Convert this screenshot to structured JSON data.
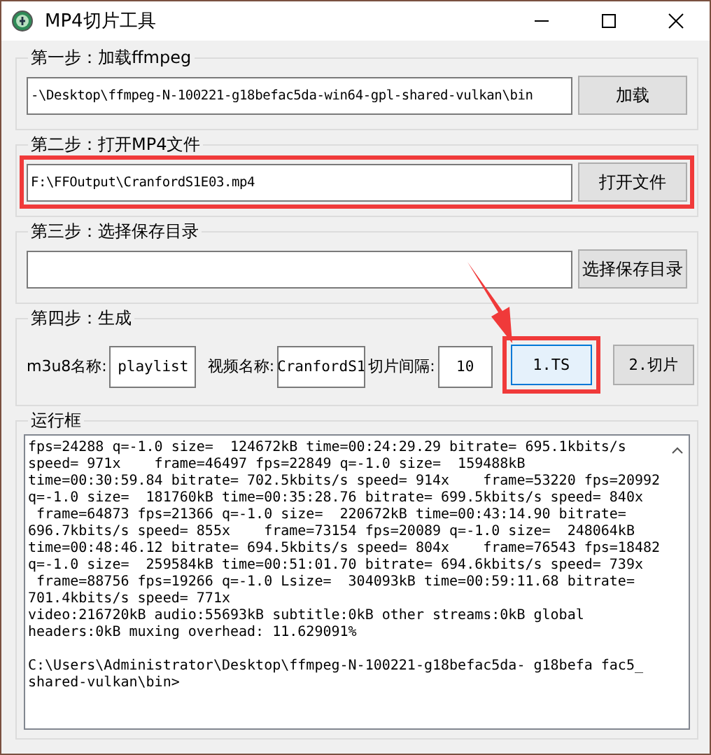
{
  "window": {
    "title": "MP4切片工具"
  },
  "steps": [
    {
      "kind": "path",
      "title": "第一步：加载ffmpeg",
      "value": "-\\Desktop\\ffmpeg-N-100221-g18befac5da-win64-gpl-shared-vulkan\\bin",
      "button": "加载",
      "highlighted": false
    },
    {
      "kind": "path",
      "title": "第二步：打开MP4文件",
      "value": "F:\\FFOutput\\CranfordS1E03.mp4",
      "button": "打开文件",
      "highlighted": true
    },
    {
      "kind": "path",
      "title": "第三步：选择保存目录",
      "button": "选择保存目录",
      "highlighted": false
    },
    {
      "kind": "generate",
      "title": "第四步：生成",
      "fields": [
        {
          "label": "m3u8名称:",
          "value": "playlist"
        },
        {
          "label": "视频名称:",
          "value": "CranfordS1"
        },
        {
          "label": "切片间隔:",
          "value": "10"
        }
      ],
      "buttons": [
        {
          "label": "1.TS",
          "focused": true,
          "highlighted": true
        },
        {
          "label": "2.切片",
          "focused": false,
          "highlighted": false
        }
      ]
    }
  ],
  "log": {
    "title": "运行框",
    "blocks": [
      [
        "fps=24288 q=-1.0 size=  124672kB time=00:24:29.29 bitrate= 695.1kbits/s",
        "speed= 971x    frame=46497 fps=22849 q=-1.0 size=  159488kB",
        "time=00:30:59.84 bitrate= 702.5kbits/s speed= 914x    frame=53220 fps=20992",
        "q=-1.0 size=  181760kB time=00:35:28.76 bitrate= 699.5kbits/s speed= 840x",
        " frame=64873 fps=21366 q=-1.0 size=  220672kB time=00:43:14.90 bitrate=",
        "696.7kbits/s speed= 855x    frame=73154 fps=20089 q=-1.0 size=  248064kB",
        "time=00:48:46.12 bitrate= 694.5kbits/s speed= 804x    frame=76543 fps=18482",
        "q=-1.0 size=  259584kB time=00:51:01.70 bitrate= 694.6kbits/s speed= 739x",
        " frame=88756 fps=19266 q=-1.0 Lsize=  304093kB time=00:59:11.68 bitrate=",
        "701.4kbits/s speed= 771x",
        "video:216720kB audio:55693kB subtitle:0kB other streams:0kB global",
        "headers:0kB muxing overhead: 11.629091%"
      ],
      [
        "C:\\Users\\Administrator\\Desktop\\ffmpeg-N-100221-g18befac5da- g18befa fac5_",
        "shared-vulkan\\bin>"
      ]
    ]
  }
}
